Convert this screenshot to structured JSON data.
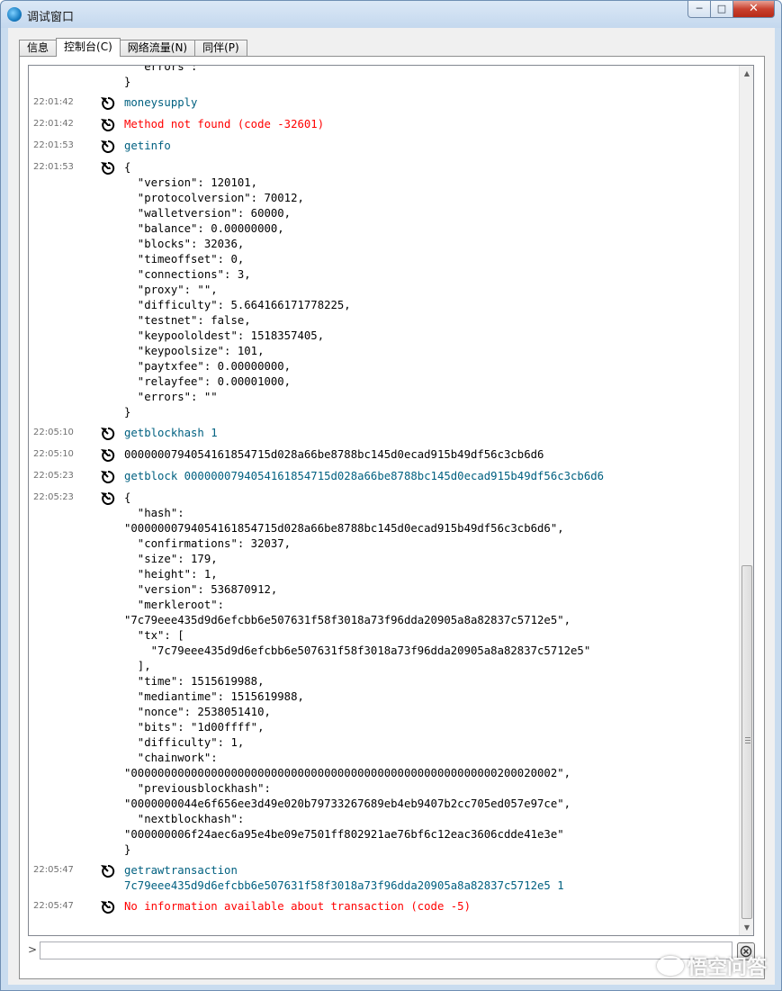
{
  "window": {
    "title": "调试窗口",
    "icon": "bitcoin-swirl-icon"
  },
  "controls": {
    "minimize": "─",
    "maximize": "□",
    "close": "✕"
  },
  "tabs": [
    {
      "label": "信息",
      "active": false
    },
    {
      "label": "控制台(C)",
      "active": true
    },
    {
      "label": "网络流量(N)",
      "active": false
    },
    {
      "label": "同伴(P)",
      "active": false
    }
  ],
  "console": {
    "entries": [
      {
        "time": "",
        "kind": "reply",
        "icon": "",
        "text": "  \"errors\": \"\"\n}"
      },
      {
        "time": "22:01:42",
        "kind": "cmd",
        "icon": "command-arrow-icon",
        "text": "moneysupply"
      },
      {
        "time": "22:01:42",
        "kind": "err",
        "icon": "reply-arrow-icon",
        "text": "Method not found (code -32601)"
      },
      {
        "time": "22:01:53",
        "kind": "cmd",
        "icon": "command-arrow-icon",
        "text": "getinfo"
      },
      {
        "time": "22:01:53",
        "kind": "reply",
        "icon": "reply-arrow-icon",
        "text": "{\n  \"version\": 120101,\n  \"protocolversion\": 70012,\n  \"walletversion\": 60000,\n  \"balance\": 0.00000000,\n  \"blocks\": 32036,\n  \"timeoffset\": 0,\n  \"connections\": 3,\n  \"proxy\": \"\",\n  \"difficulty\": 5.664166171778225,\n  \"testnet\": false,\n  \"keypoololdest\": 1518357405,\n  \"keypoolsize\": 101,\n  \"paytxfee\": 0.00000000,\n  \"relayfee\": 0.00001000,\n  \"errors\": \"\"\n}"
      },
      {
        "time": "22:05:10",
        "kind": "cmd",
        "icon": "command-arrow-icon",
        "text": "getblockhash 1"
      },
      {
        "time": "22:05:10",
        "kind": "reply",
        "icon": "reply-arrow-icon",
        "text": "0000000794054161854715d028a66be8788bc145d0ecad915b49df56c3cb6d6"
      },
      {
        "time": "22:05:23",
        "kind": "cmd",
        "icon": "command-arrow-icon",
        "text": "getblock 0000000794054161854715d028a66be8788bc145d0ecad915b49df56c3cb6d6"
      },
      {
        "time": "22:05:23",
        "kind": "reply",
        "icon": "reply-arrow-icon",
        "text": "{\n  \"hash\":\n\"0000000794054161854715d028a66be8788bc145d0ecad915b49df56c3cb6d6\",\n  \"confirmations\": 32037,\n  \"size\": 179,\n  \"height\": 1,\n  \"version\": 536870912,\n  \"merkleroot\":\n\"7c79eee435d9d6efcbb6e507631f58f3018a73f96dda20905a8a82837c5712e5\",\n  \"tx\": [\n    \"7c79eee435d9d6efcbb6e507631f58f3018a73f96dda20905a8a82837c5712e5\"\n  ],\n  \"time\": 1515619988,\n  \"mediantime\": 1515619988,\n  \"nonce\": 2538051410,\n  \"bits\": \"1d00ffff\",\n  \"difficulty\": 1,\n  \"chainwork\":\n\"0000000000000000000000000000000000000000000000000000000200020002\",\n  \"previousblockhash\":\n\"0000000044e6f656ee3d49e020b79733267689eb4eb9407b2cc705ed057e97ce\",\n  \"nextblockhash\":\n\"000000006f24aec6a95e4be09e7501ff802921ae76bf6c12eac3606cdde41e3e\"\n}"
      },
      {
        "time": "22:05:47",
        "kind": "cmd",
        "icon": "command-arrow-icon",
        "text": "getrawtransaction\n7c79eee435d9d6efcbb6e507631f58f3018a73f96dda20905a8a82837c5712e5 1"
      },
      {
        "time": "22:05:47",
        "kind": "err",
        "icon": "reply-arrow-icon",
        "text": "No information available about transaction (code -5)"
      }
    ]
  },
  "input": {
    "prompt": ">",
    "value": ""
  },
  "scrollbar": {
    "position_fraction": 1.0
  },
  "watermark": {
    "text": "悟空问答"
  },
  "colors": {
    "command": "#006080",
    "error": "#ff0000",
    "reply": "#000000"
  }
}
